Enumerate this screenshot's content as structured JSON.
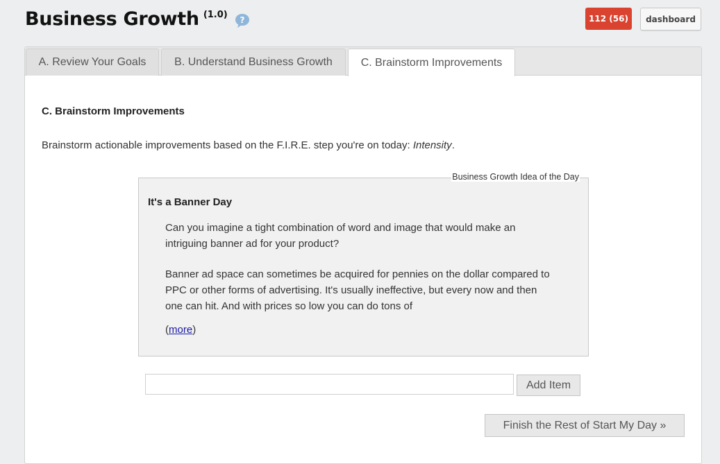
{
  "header": {
    "title": "Business Growth",
    "version": "(1.0)",
    "help_icon": "help-bubble-icon",
    "badge": "112 (56)",
    "dashboard_label": "dashboard"
  },
  "colors": {
    "badge": "#d9432f",
    "help_icon": "#8fb6d9",
    "link": "#1a1aa6"
  },
  "tabs": [
    {
      "label": "A. Review Your Goals",
      "active": false
    },
    {
      "label": "B. Understand Business Growth",
      "active": false
    },
    {
      "label": "C. Brainstorm Improvements",
      "active": true
    }
  ],
  "main": {
    "section_title": "C. Brainstorm Improvements",
    "intro_text": "Brainstorm actionable improvements based on the F.I.R.E. step you're on today: ",
    "intro_emphasis": "Intensity",
    "intro_end": "."
  },
  "idea": {
    "legend": "Business Growth Idea of the Day",
    "title": "It's a Banner Day",
    "paragraphs": [
      "Can you imagine a tight combination of word and image that would make an intriguing banner ad for your product?",
      "Banner ad space can sometimes be acquired for pennies on the dollar compared to PPC or other forms of advertising. It's usually ineffective, but every now and then one can hit. And with prices so low you can do tons of"
    ],
    "more_open": "(",
    "more_label": "more",
    "more_close": ")"
  },
  "form": {
    "input_value": "",
    "add_label": "Add Item",
    "finish_label": "Finish the Rest of Start My Day »"
  }
}
